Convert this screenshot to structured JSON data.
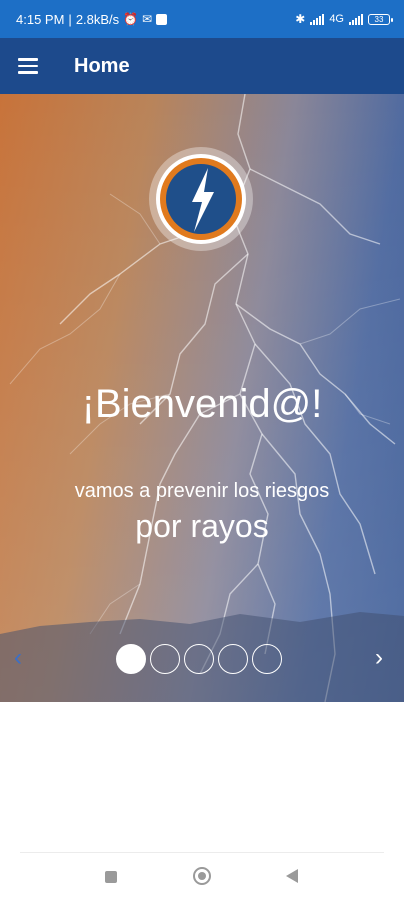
{
  "status_bar": {
    "time": "4:15 PM",
    "speed": "2.8kB/s",
    "network_label": "4G",
    "battery": "33",
    "icons": [
      "alarm-icon",
      "mail-icon",
      "bluetooth-icon",
      "signal-icon",
      "battery-icon"
    ]
  },
  "app_bar": {
    "title": "Home",
    "menu_icon": "hamburger-menu-icon",
    "color": "#1d4a8c"
  },
  "hero": {
    "welcome": "¡Bienvenid@!",
    "subtitle_line1": "vamos a prevenir los riesgos",
    "subtitle_line2": "por rayos",
    "logo_icon": "lightning-bolt-icon",
    "prev_arrow": "‹",
    "next_arrow": "›",
    "carousel": {
      "total_pages": 5,
      "current_page": 1
    }
  },
  "nav_bar": {
    "buttons": [
      "recents-button",
      "home-button",
      "back-button"
    ]
  },
  "colors": {
    "status_bar": "#1d6fc6",
    "logo_ring": "#e07a1e",
    "logo_fill": "#1f4f8a"
  }
}
